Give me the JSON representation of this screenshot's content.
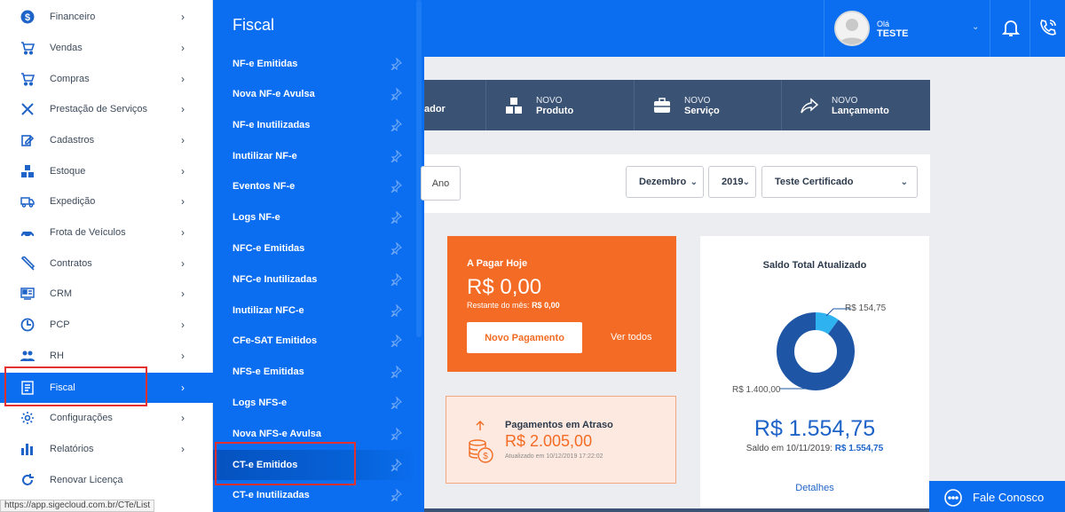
{
  "sidebar": {
    "items": [
      {
        "label": "Financeiro",
        "icon": "dollar-circle-icon"
      },
      {
        "label": "Vendas",
        "icon": "cart-icon"
      },
      {
        "label": "Compras",
        "icon": "cart-icon"
      },
      {
        "label": "Prestação de Serviços",
        "icon": "tools-icon"
      },
      {
        "label": "Cadastros",
        "icon": "edit-icon"
      },
      {
        "label": "Estoque",
        "icon": "boxes-icon"
      },
      {
        "label": "Expedição",
        "icon": "truck-icon"
      },
      {
        "label": "Frota de Veículos",
        "icon": "car-icon"
      },
      {
        "label": "Contratos",
        "icon": "pen-icon"
      },
      {
        "label": "CRM",
        "icon": "id-card-icon"
      },
      {
        "label": "PCP",
        "icon": "clock-chart-icon"
      },
      {
        "label": "RH",
        "icon": "users-icon"
      },
      {
        "label": "Fiscal",
        "icon": "receipt-icon",
        "active": true
      },
      {
        "label": "Configurações",
        "icon": "gear-icon"
      },
      {
        "label": "Relatórios",
        "icon": "bar-chart-icon"
      },
      {
        "label": "Renovar Licença",
        "icon": "refresh-icon"
      }
    ],
    "chevron": "›"
  },
  "status_url": "https://app.sigecloud.com.br/CTe/List",
  "submenu": {
    "title": "Fiscal",
    "items": [
      "NF-e Emitidas",
      "Nova NF-e Avulsa",
      "NF-e Inutilizadas",
      "Inutilizar NF-e",
      "Eventos NF-e",
      "Logs NF-e",
      "NFC-e Emitidas",
      "NFC-e Inutilizadas",
      "Inutilizar NFC-e",
      "CFe-SAT Emitidos",
      "NFS-e Emitidas",
      "Logs NFS-e",
      "Nova NFS-e Avulsa",
      "CT-e Emitidos",
      "CT-e Inutilizadas"
    ],
    "highlighted": "CT-e Emitidos"
  },
  "header": {
    "greeting": "Olá",
    "user_name": "TESTE"
  },
  "quick_actions": {
    "partial_label": "ador",
    "items": [
      {
        "small": "NOVO",
        "big": "Produto",
        "icon": "boxes-icon"
      },
      {
        "small": "NOVO",
        "big": "Serviço",
        "icon": "briefcase-icon"
      },
      {
        "small": "NOVO",
        "big": "Lançamento",
        "icon": "share-arrow-icon"
      }
    ]
  },
  "filters": {
    "ano_button": "Ano",
    "month": "Dezembro",
    "year": "2019",
    "company": "Teste Certificado"
  },
  "card_pay_today": {
    "title": "A Pagar Hoje",
    "amount": "R$ 0,00",
    "rest_label": "Restante do mês:",
    "rest_value": "R$ 0,00",
    "button": "Novo Pagamento",
    "link": "Ver todos"
  },
  "card_late": {
    "title": "Pagamentos em Atraso",
    "amount": "R$ 2.005,00",
    "updated": "Atualizado em 10/12/2019 17:22:02"
  },
  "card_balance": {
    "title": "Saldo Total Atualizado",
    "total": "R$ 1.554,75",
    "sub_label": "Saldo em 10/11/2019:",
    "sub_value": "R$ 1.554,75",
    "details": "Detalhes",
    "slice_labels": [
      "R$ 154,75",
      "R$ 1.400,00"
    ],
    "slice_values": [
      154.75,
      1400.0
    ],
    "colors": [
      "#2fb3f0",
      "#1e55a5"
    ]
  },
  "chat": {
    "label": "Fale Conosco"
  }
}
